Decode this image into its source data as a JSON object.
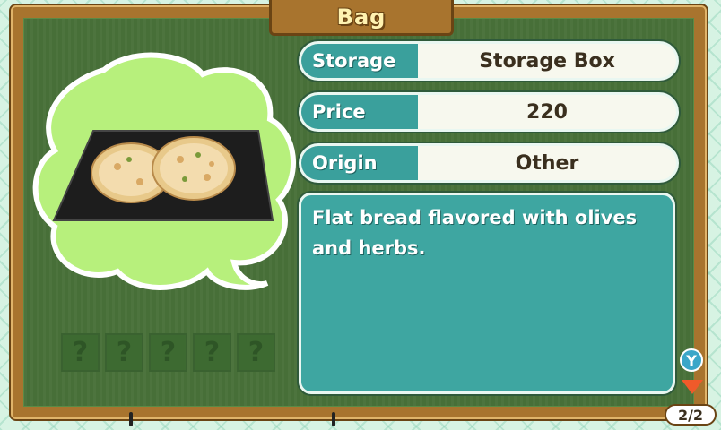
{
  "header": {
    "title": "Bag"
  },
  "item": {
    "fields": [
      {
        "label": "Storage",
        "value": "Storage Box"
      },
      {
        "label": "Price",
        "value": "220"
      },
      {
        "label": "Origin",
        "value": "Other"
      }
    ],
    "description": "Flat bread flavored with olives and herbs.",
    "image": "focaccia-bread-on-tray"
  },
  "ingredients": {
    "slots": [
      "?",
      "?",
      "?",
      "?",
      "?"
    ]
  },
  "controls": {
    "y_button": "Y",
    "page_indicator": "2/2"
  },
  "colors": {
    "frame": "#a8742e",
    "board": "#476f38",
    "label_teal": "#3aa09c",
    "bubble": "#b7f07c"
  }
}
